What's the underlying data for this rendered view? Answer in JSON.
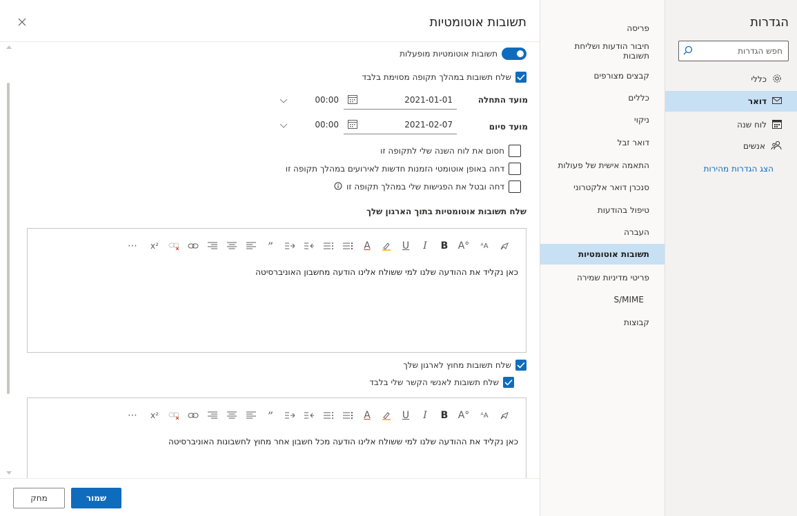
{
  "settings": {
    "title": "הגדרות",
    "search_placeholder": "חפש הגדרות",
    "categories": [
      {
        "label": "כללי",
        "icon": "gear-icon"
      },
      {
        "label": "דואר",
        "icon": "mail-icon",
        "selected": true
      },
      {
        "label": "לוח שנה",
        "icon": "calendar-icon"
      },
      {
        "label": "אנשים",
        "icon": "people-icon"
      }
    ],
    "quick_settings": "הצג הגדרות מהירות"
  },
  "subnav": {
    "items": [
      {
        "label": "פריסה"
      },
      {
        "label": "חיבור הודעות ושליחת תשובות"
      },
      {
        "label": "קבצים מצורפים"
      },
      {
        "label": "כללים"
      },
      {
        "label": "ניקוי"
      },
      {
        "label": "דואר זבל"
      },
      {
        "label": "התאמה אישית של פעולות"
      },
      {
        "label": "סנכרן דואר אלקטרוני"
      },
      {
        "label": "טיפול בהודעות"
      },
      {
        "label": "העברה"
      },
      {
        "label": "תשובות אוטומטיות",
        "selected": true
      },
      {
        "label": "פריטי מדיניות שמירה"
      },
      {
        "label": "S/MIME"
      },
      {
        "label": "קבוצות"
      }
    ]
  },
  "panel": {
    "title": "תשובות אוטומטיות",
    "toggle_label": "תשובות אוטומטיות מופעלות",
    "time_period_label": "שלח תשובות במהלך תקופה מסוימת בלבד",
    "start_label": "מועד התחלה",
    "start_date": "2021-01-01",
    "start_time": "00:00",
    "end_label": "מועד סיום",
    "end_date": "2021-02-07",
    "end_time": "00:00",
    "block_calendar": "חסום את לוח השנה שלי לתקופה זו",
    "decline_new": "דחה באופן אוטומטי הזמנות חדשות לאירועים במהלך תקופה זו",
    "decline_cancel": "דחה ובטל את הפגישות שלי במהלך תקופה זו",
    "inside_heading": "שלח תשובות אוטומטיות בתוך הארגון שלך",
    "inside_message": "כאן נקליד את ההודעה שלנו למי ששולח אלינו הודעה מחשבון האוניברסיטה",
    "outside_label": "שלח תשובות מחוץ לארגון שלך",
    "contacts_only_label": "שלח תשובות לאנשי הקשר שלי בלבד",
    "outside_message": "כאן נקליד את ההודעה שלנו למי ששולח אלינו הודעה מכל חשבון אחר מחוץ לחשבונות האוניברסיטה",
    "save": "שמור",
    "discard": "מחק"
  },
  "toolbar_labels": {
    "quote": "”",
    "bold": "B",
    "italic": "I",
    "underline": "U",
    "font_color": "A",
    "more": "⋯",
    "superscript": "x²"
  },
  "colors": {
    "accent": "#0f6cbd",
    "selected_bg": "#c7e0f4"
  }
}
